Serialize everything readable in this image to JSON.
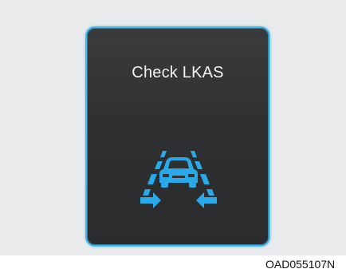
{
  "display": {
    "message": "Check LKAS",
    "icon": "lane-keeping-assist-icon",
    "accent_color": "#29a9e8"
  },
  "caption": {
    "code": "OAD055107N"
  }
}
